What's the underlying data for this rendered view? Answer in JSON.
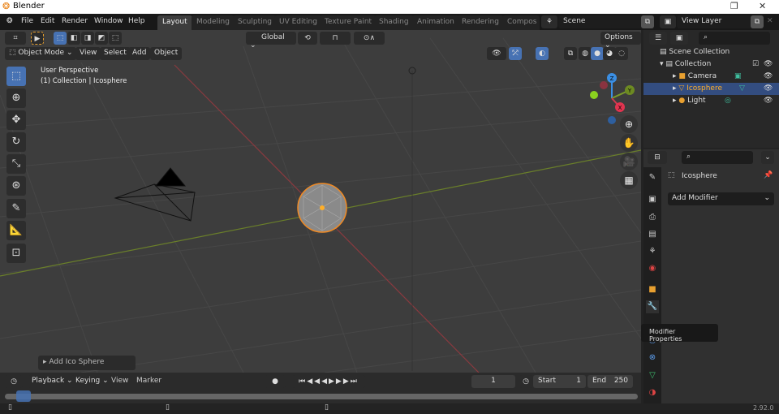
{
  "window": {
    "title": "Blender"
  },
  "menu": [
    "File",
    "Edit",
    "Render",
    "Window",
    "Help"
  ],
  "workspaces": [
    "Layout",
    "Modeling",
    "Sculpting",
    "UV Editing",
    "Texture Paint",
    "Shading",
    "Animation",
    "Rendering",
    "Compos"
  ],
  "scene": {
    "name": "Scene",
    "view_layer": "View Layer"
  },
  "viewport": {
    "orientation": "Global",
    "options": "Options",
    "mode": "Object Mode",
    "menus": [
      "View",
      "Select",
      "Add",
      "Object"
    ],
    "perspective": "User Perspective",
    "context": "(1) Collection | Icosphere",
    "last_op": "Add Ico Sphere",
    "gizmo": {
      "x": "X",
      "y": "Y",
      "z": "Z"
    }
  },
  "outliner": {
    "scene_collection": "Scene Collection",
    "collection": "Collection",
    "items": [
      {
        "name": "Camera",
        "selected": false
      },
      {
        "name": "Icosphere",
        "selected": true
      },
      {
        "name": "Light",
        "selected": false
      }
    ]
  },
  "properties": {
    "object_name": "Icosphere",
    "add_modifier": "Add Modifier",
    "tooltip": "Modifier Properties"
  },
  "timeline": {
    "menus": [
      "Playback",
      "Keying",
      "View",
      "Marker"
    ],
    "current_frame": "1",
    "start_label": "Start",
    "start": "1",
    "end_label": "End",
    "end": "250"
  },
  "status": {
    "version": "2.92.0"
  },
  "colors": {
    "accent": "#4772b3",
    "selected_text": "#ffaf29",
    "object_outline": "#f08a24"
  }
}
